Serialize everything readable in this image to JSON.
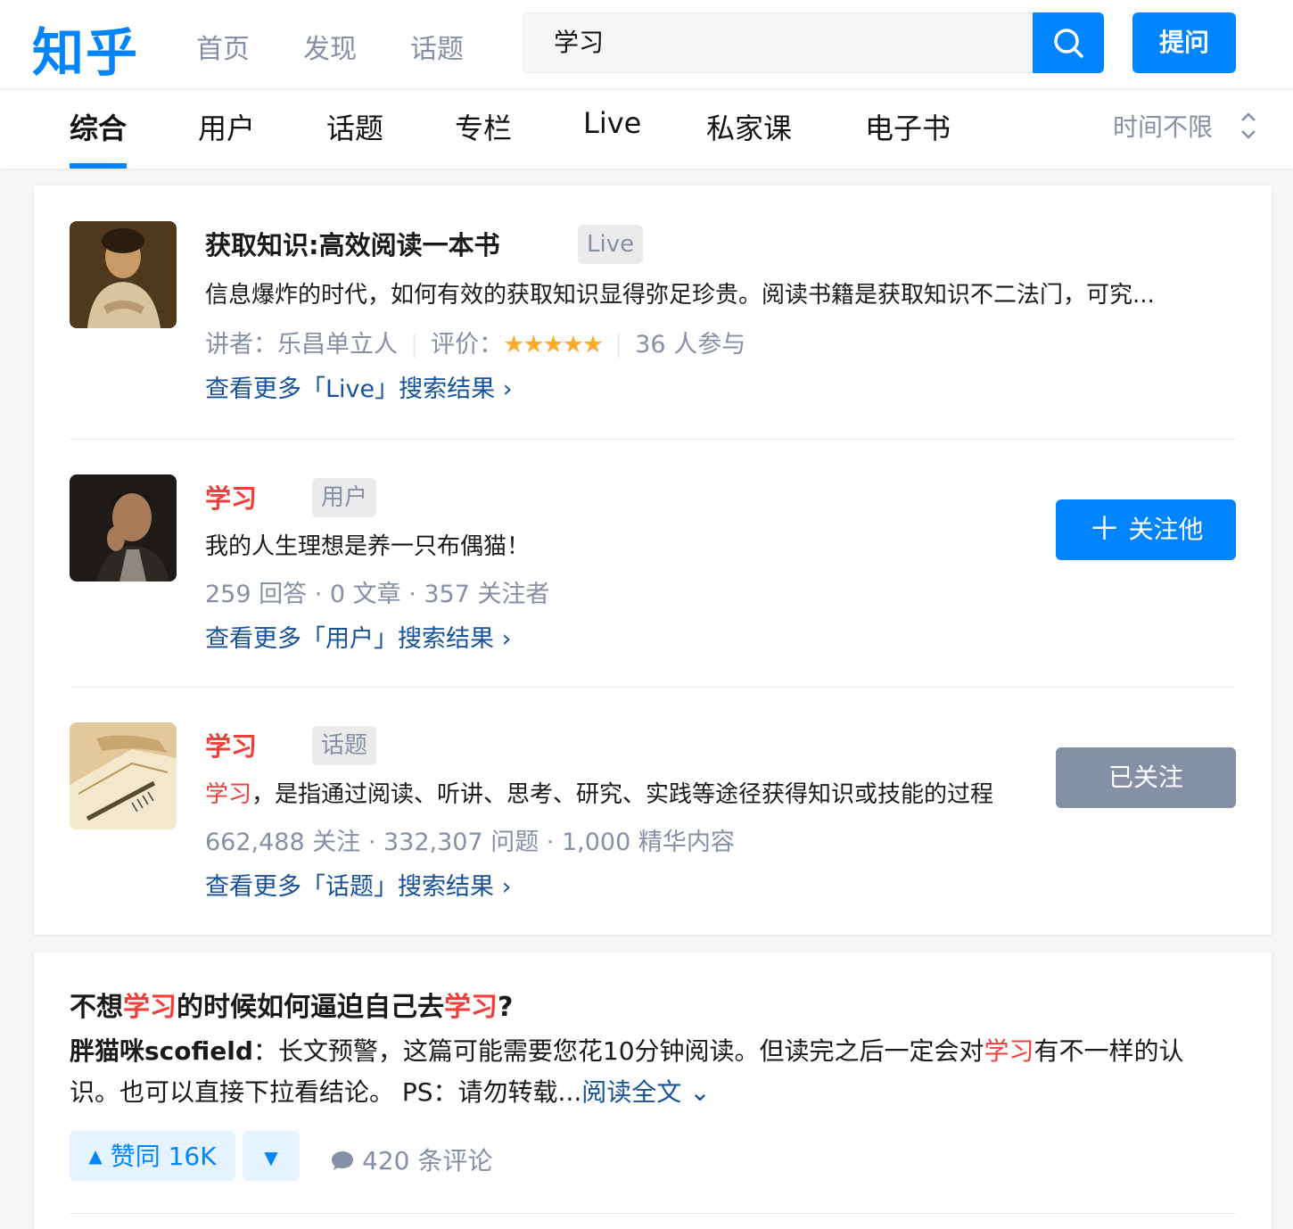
{
  "header": {
    "logo": "知乎",
    "nav": [
      "首页",
      "发现",
      "话题"
    ],
    "search_value": "学习",
    "ask_label": "提问"
  },
  "tabs": {
    "items": [
      "综合",
      "用户",
      "话题",
      "专栏",
      "Live",
      "私家课",
      "电子书"
    ],
    "active": "综合",
    "time_filter": "时间不限"
  },
  "results": {
    "live": {
      "title": "获取知识:高效阅读一本书",
      "tag": "Live",
      "desc": "信息爆炸的时代，如何有效的获取知识显得弥足珍贵。阅读书籍是获取知识不二法门，可究...",
      "speaker": "讲者：乐昌单立人",
      "rating_label": "评价：",
      "rating": 4.5,
      "rating_stars": "★★★★★",
      "participants": "36 人参与",
      "more": "查看更多「Live」搜索结果"
    },
    "user": {
      "name": "学习",
      "tag": "用户",
      "bio": "我的人生理想是养一只布偶猫！",
      "stats": "259 回答 · 0 文章 · 357 关注者",
      "follow_label": "关注他",
      "more": "查看更多「用户」搜索结果"
    },
    "topic": {
      "name": "学习",
      "tag": "话题",
      "desc_highlight": "学习",
      "desc_rest": "，是指通过阅读、听讲、思考、研究、实践等途径获得知识或技能的过程",
      "stats": "662,488 关注 · 332,307 问题 · 1,000 精华内容",
      "follow_label": "已关注",
      "more": "查看更多「话题」搜索结果"
    }
  },
  "answer": {
    "title_parts": [
      "不想",
      "学习",
      "的时候如何逼迫自己去",
      "学习",
      "?"
    ],
    "author": "胖猫咪scofield",
    "body_a": "：长文预警，这篇可能需要您花10分钟阅读。但读完之后一定会对",
    "body_hl": "学习",
    "body_b": "有不一样的认识。也可以直接下拉看结论。 PS：请勿转载...",
    "read_more": "阅读全文",
    "upvote": "赞同 16K",
    "comments": "420 条评论"
  },
  "colors": {
    "brand": "#0084ff",
    "highlight": "#f1403c",
    "link": "#175199",
    "muted": "#8590a6",
    "star": "#ffab2e"
  }
}
